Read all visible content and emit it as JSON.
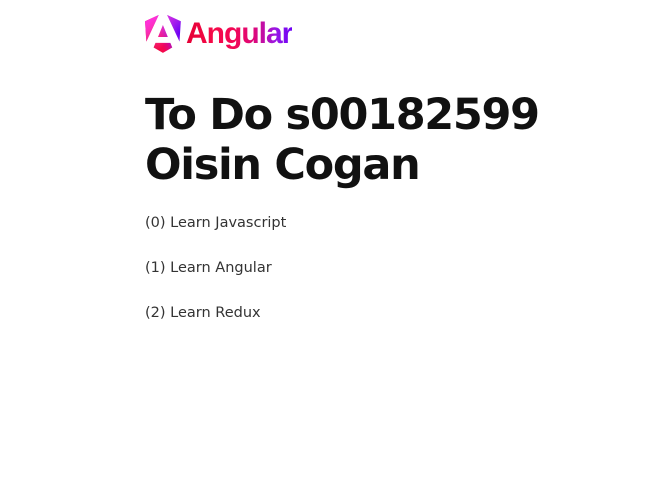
{
  "brand": {
    "name": "Angular",
    "logo_icon": "angular-logo-icon"
  },
  "heading": "To Do s00182599 Oisin Cogan",
  "todos": [
    {
      "index": "(0)",
      "text": "Learn Javascript"
    },
    {
      "index": "(1)",
      "text": "Learn Angular"
    },
    {
      "index": "(2)",
      "text": "Learn Redux"
    }
  ]
}
